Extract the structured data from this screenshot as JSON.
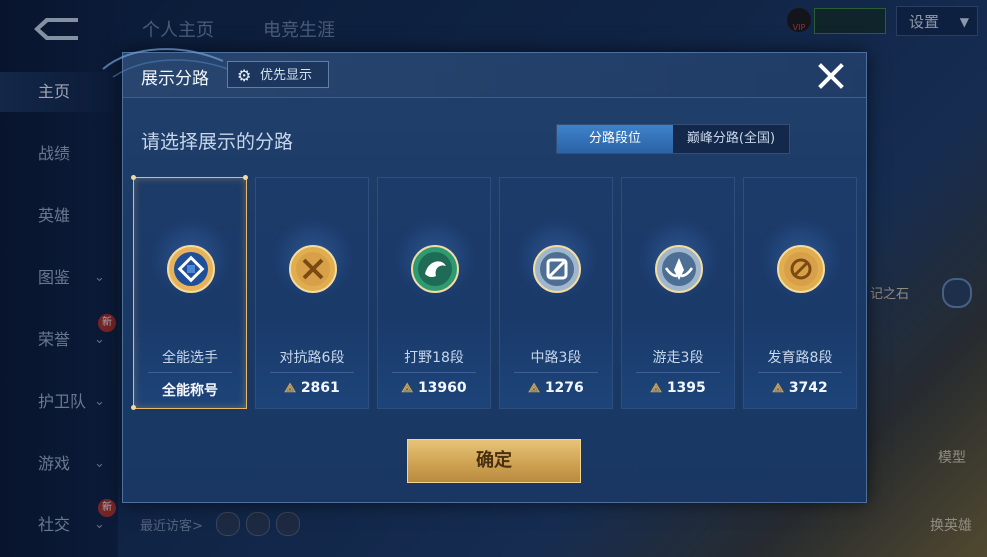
{
  "left_nav": {
    "items": [
      {
        "label": "主页",
        "active": true,
        "chevron": false,
        "badge": ""
      },
      {
        "label": "战绩",
        "active": false,
        "chevron": false,
        "badge": ""
      },
      {
        "label": "英雄",
        "active": false,
        "chevron": false,
        "badge": ""
      },
      {
        "label": "图鉴",
        "active": false,
        "chevron": true,
        "badge": ""
      },
      {
        "label": "荣誉",
        "active": false,
        "chevron": true,
        "badge": "新"
      },
      {
        "label": "护卫队",
        "active": false,
        "chevron": true,
        "badge": ""
      },
      {
        "label": "游戏",
        "active": false,
        "chevron": true,
        "badge": ""
      },
      {
        "label": "社交",
        "active": false,
        "chevron": true,
        "badge": "新"
      }
    ]
  },
  "top_tabs": [
    "个人主页",
    "电竞生涯"
  ],
  "settings": {
    "label": "设置"
  },
  "vip_badge": {
    "label": "VIP"
  },
  "background": {
    "side_text": "记之石",
    "right_labels": [
      "模型",
      "换英雄"
    ],
    "recent_visitors_label": "最近访客>"
  },
  "dialog": {
    "title": "展示分路",
    "priority_button": "优先显示",
    "prompt": "请选择展示的分路",
    "segments": [
      {
        "label": "分路段位",
        "active": true
      },
      {
        "label": "巅峰分路(全国)",
        "active": false
      }
    ],
    "cards": [
      {
        "name": "全能选手",
        "score": "全能称号",
        "score_icon": false,
        "selected": true,
        "emblem": "all-round-emblem-icon",
        "color": "#e6b35a"
      },
      {
        "name": "对抗路6段",
        "score": "2861",
        "score_icon": true,
        "selected": false,
        "emblem": "clash-lane-emblem-icon",
        "color": "#e0ad4f"
      },
      {
        "name": "打野18段",
        "score": "13960",
        "score_icon": true,
        "selected": false,
        "emblem": "jungle-emblem-icon",
        "color": "#2e9a72"
      },
      {
        "name": "中路3段",
        "score": "1276",
        "score_icon": true,
        "selected": false,
        "emblem": "mid-lane-emblem-icon",
        "color": "#9fb6cc"
      },
      {
        "name": "游走3段",
        "score": "1395",
        "score_icon": true,
        "selected": false,
        "emblem": "roam-emblem-icon",
        "color": "#9fb6cc"
      },
      {
        "name": "发育路8段",
        "score": "3742",
        "score_icon": true,
        "selected": false,
        "emblem": "farm-lane-emblem-icon",
        "color": "#e0ad4f"
      }
    ],
    "confirm_button": "确定"
  },
  "colors": {
    "accent_gold": "#d2a656",
    "active_segment": "#3f82c9",
    "selected_border": "#e7b86a"
  }
}
